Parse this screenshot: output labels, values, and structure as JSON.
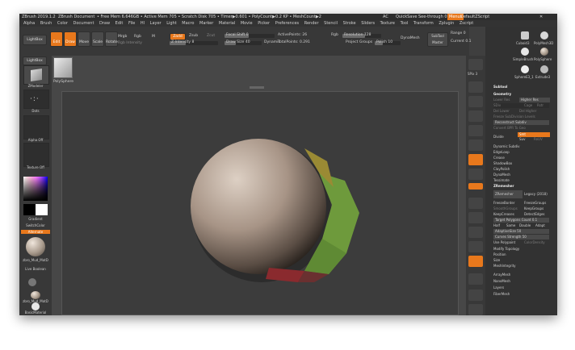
{
  "title": {
    "app": "ZBrush 2019.1.2",
    "document": "ZBrush Document",
    "stats": "• Free Mem 6.646GB • Active Mem 705 • Scratch Disk 705 • Timer▶0.601 • PolyCount▶0.2 KP • MeshCount▶2",
    "ac": "AC",
    "quicksave": "QuickSave",
    "seethrough": "See-through 0",
    "menus": "Menus",
    "defaultzscript": "DefaultZScript"
  },
  "menu": [
    "Alpha",
    "Brush",
    "Color",
    "Document",
    "Draw",
    "Edit",
    "File",
    "Hl",
    "Layer",
    "Light",
    "Macro",
    "Marker",
    "Material",
    "Movie",
    "Picker",
    "Preferences",
    "Render",
    "Stencil",
    "Stroke",
    "Sliders",
    "Texture",
    "Tool",
    "Transform",
    "Zplugin",
    "Zscript"
  ],
  "toolbar": {
    "lightbox": "LightBox",
    "edit": "Edit",
    "draw": "Draw",
    "move": "Move",
    "scale": "Scale",
    "rotate": "Rotate",
    "mrgb": "Mrgb",
    "rgb": "Rgb",
    "m": "M",
    "rgb_intensity": "Rgb Intensity",
    "zadd": "Zadd",
    "zsub": "Zsub",
    "zcut": "Zcut",
    "z_intensity": "Z Intensity 8",
    "focal_shift": "Focal Shift 0",
    "draw_size": "Draw Size 40",
    "dynamic": "Dynamic",
    "active_points": "ActivePoints: 26",
    "total_points": "TotalPoints: 0.291",
    "rgb2": "Rgb",
    "resolution": "Resolution 128",
    "project": "Project",
    "groups": "Groups",
    "polish": "Polish 10",
    "dynamesh": "DynaMesh",
    "subtool_master": "SubTool Master",
    "range": "Range 0",
    "current": "Current 0.1",
    "back": "Back"
  },
  "left": {
    "cube_label": "ZModeler",
    "dots_label": "Dots",
    "alpha": "Alpha Off",
    "texture": "Texture Off",
    "gradient": "Gradient",
    "switchcolor": "SwitchColor",
    "alternate": "Alternate",
    "material_label": "zbro_Mud_MatD",
    "live_boolean": "Live Boolean",
    "material2": "zbro_Mud_MatD",
    "basic_material": "BasicMaterial",
    "dot_cursor": "Dot_Cursor"
  },
  "canvas": {
    "polysphere": "PolySphere"
  },
  "shelf": [
    "SPix 3",
    "Scroll",
    "Zoom",
    "Actual",
    "AAHalf",
    "Persp",
    "Floor",
    "Local",
    "Gizmo",
    "Frame",
    "Move",
    "Scale",
    "Rotate",
    "Transp",
    "Ghost",
    "Solo",
    "Xpose"
  ],
  "right": {
    "tools": [
      "Cuboid3",
      "PolyMesh3D",
      "SimpleBrush",
      "PolySphere",
      "SphereE3_1",
      "Extrude3"
    ],
    "subtool": "Subtool",
    "geometry": "Geometry",
    "lower_res": "Lower Res",
    "higher_res": "Higher Res",
    "sdiv": "SDiv",
    "cage": "Cage",
    "rstr": "Rstr",
    "del_lower": "Del Lower",
    "del_higher": "Del Higher",
    "freeze": "Freeze SubDivision Levels",
    "reconstruct": "Reconstruct Subdiv",
    "convert_bpr": "Convert BPR To Geo",
    "divide": "Divide",
    "smt": "Smt",
    "suv": "Suv",
    "reuv": "ReUV",
    "dynamic_subdiv": "Dynamic Subdiv",
    "edgeloop": "EdgeLoop",
    "crease": "Crease",
    "shadowbox": "ShadowBox",
    "claypolish": "ClayPolish",
    "dynamesh": "DynaMesh",
    "tessimate": "Tessimate",
    "zremesher_head": "ZRemesher",
    "zremesher_btn": "ZRemesher",
    "legacy": "Legacy (2018)",
    "freezeborder": "FreezeBorder",
    "freezegroups": "FreezeGroups",
    "smoothgroups": "SmoothGroups",
    "keepgroups": "KeepGroups",
    "keepcreases": "KeepCreases",
    "detectedges": "DetectEdges",
    "target_polycount": "Target Polygons Count 0.1",
    "half": "Half",
    "same": "Same",
    "double": "Double",
    "adapt": "Adapt",
    "adaptivesize": "AdaptiveSize 50",
    "curves_strength": "Curves Strength 50",
    "use_polypaint": "Use Polypaint",
    "color_density": "ColorDensity",
    "modify_topology": "Modify Topology",
    "position": "Position",
    "size": "Size",
    "meshintegrity": "MeshIntegrity",
    "arraymesh": "ArrayMesh",
    "nanomesh": "NanoMesh",
    "layers": "Layers",
    "fibermesh": "FiberMesh"
  }
}
